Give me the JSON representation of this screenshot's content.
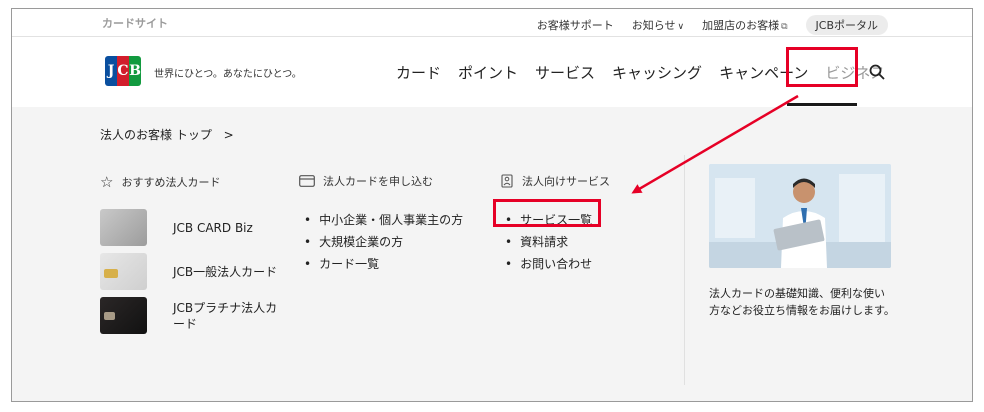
{
  "utility_bar": {
    "site_label": "カードサイト",
    "links": [
      "お客様サポート",
      "お知らせ",
      "加盟店のお客様",
      "JCBポータル"
    ]
  },
  "header": {
    "logo_text": [
      "J",
      "C",
      "B"
    ],
    "tagline": "世界にひとつ。あなたにひとつ。",
    "nav": [
      "カード",
      "ポイント",
      "サービス",
      "キャッシング",
      "キャンペーン",
      "ビジネス"
    ],
    "active_nav": "ビジネス"
  },
  "mega_menu": {
    "breadcrumb": "法人のお客様 トップ",
    "recommended": {
      "heading": "おすすめ法人カード",
      "cards": [
        "JCB CARD Biz",
        "JCB一般法人カード",
        "JCBプラチナ法人カ\nード"
      ]
    },
    "apply": {
      "heading": "法人カードを申し込む",
      "items": [
        "中小企業・個人事業主の方",
        "大規模企業の方",
        "カード一覧"
      ]
    },
    "services": {
      "heading": "法人向けサービス",
      "items": [
        "サービス一覧",
        "資料請求",
        "お問い合わせ"
      ]
    },
    "feature": {
      "description": "法人カードの基礎知識、便利な使い方などお役立ち情報をお届けします。"
    }
  },
  "colors": {
    "highlight": "#e60026",
    "jcb_blue": "#0a4f9f",
    "jcb_red": "#d21e2c",
    "jcb_green": "#129a3f"
  }
}
